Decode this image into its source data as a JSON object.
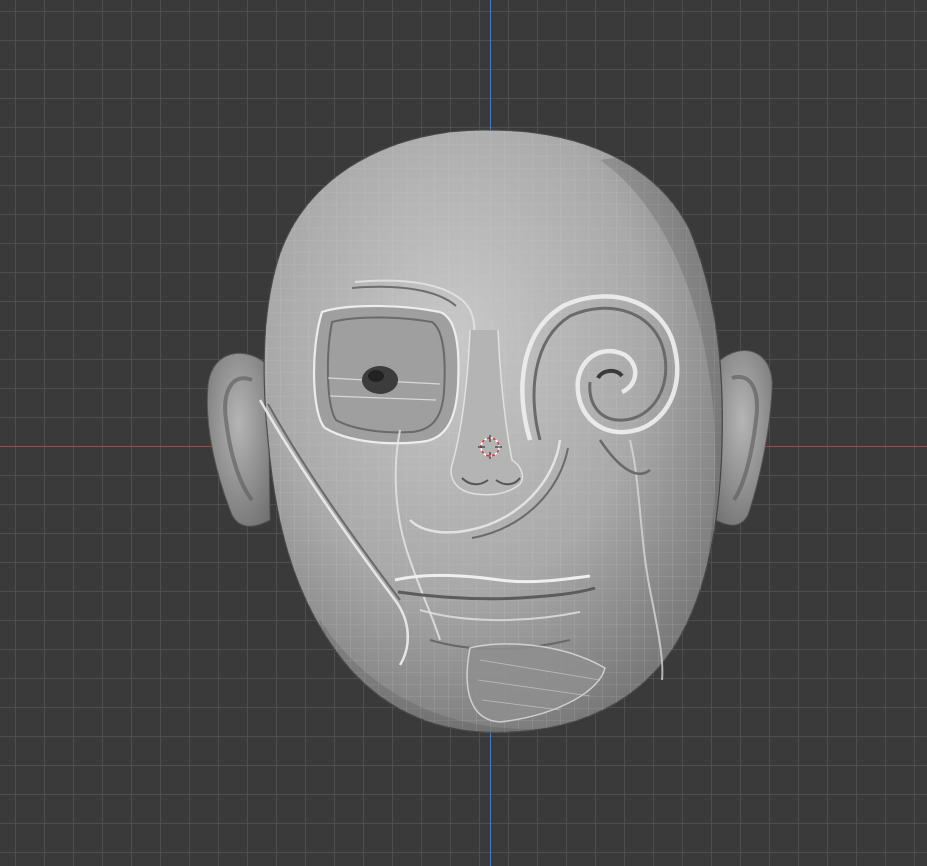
{
  "viewport": {
    "background_color": "#3a3a3a",
    "grid_color": "#505050",
    "x_axis_color": "#a84545",
    "y_axis_color": "#4a7ac2"
  },
  "scene": {
    "object": "sculpted-head-mesh",
    "mesh_color": "#a6a6a6",
    "cursor_icon": "3d-cursor-icon"
  }
}
